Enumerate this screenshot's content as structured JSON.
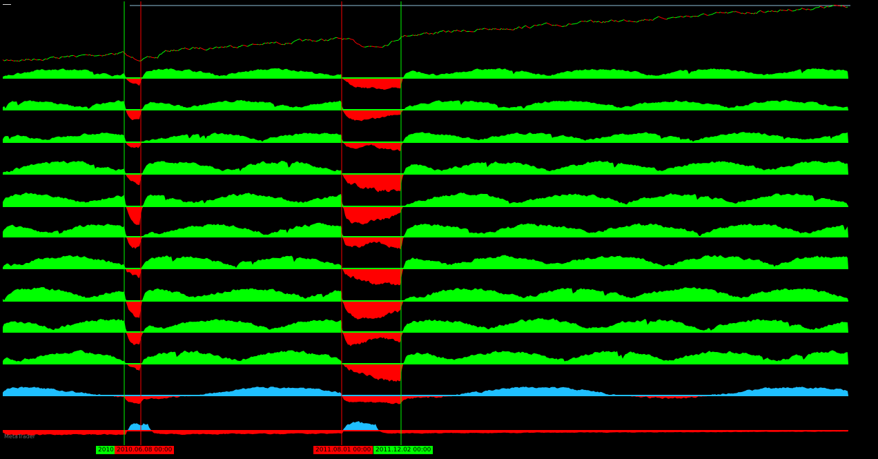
{
  "chart_data": {
    "type": "area",
    "price_panel": {
      "type": "line",
      "description_colors": {
        "up": "#00ff00",
        "down": "#ff0000"
      },
      "start_value": 0.0,
      "end_value": 1.0
    },
    "colors": {
      "positive": "#00ff00",
      "negative": "#ff0000",
      "cyan_positive": "#1fbfff",
      "markline_buy": "#00ff00",
      "markline_sell": "#ff0000",
      "background": "#000000"
    },
    "panel_count": 12,
    "markers": [
      {
        "label": "2010",
        "kind": "buy"
      },
      {
        "label": "2010.06.08 00:00",
        "kind": "sell"
      },
      {
        "label": "2011.08.01 00:00",
        "kind": "sell"
      },
      {
        "label": "2011.12.02 00:00",
        "kind": "buy"
      }
    ],
    "watermark": "MetaTrader"
  }
}
